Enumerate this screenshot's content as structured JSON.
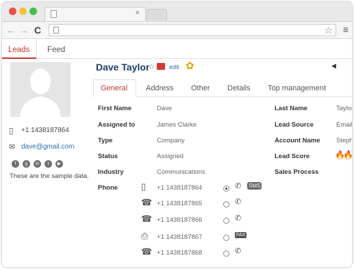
{
  "browser": {
    "close_glyph": "×",
    "menu_glyph": "≡",
    "star_glyph": "☆"
  },
  "app_tabs": [
    {
      "label": "Leads"
    },
    {
      "label": "Feed"
    }
  ],
  "contact": {
    "name": "Dave Taylor",
    "edit_label": "edit",
    "phone": "+1 1438187864",
    "email": "dave@gmail.com",
    "blurb": "These are the sample data."
  },
  "profile_tabs": [
    {
      "label": "General"
    },
    {
      "label": "Address"
    },
    {
      "label": "Other"
    },
    {
      "label": "Details"
    },
    {
      "label": "Top management"
    }
  ],
  "fields_left": [
    {
      "label": "First Name",
      "value": "Dave"
    },
    {
      "label": "Assigned to",
      "value": "James Clarke"
    },
    {
      "label": "Type",
      "value": "Company"
    },
    {
      "label": "Status",
      "value": "Assigned"
    },
    {
      "label": "Industry",
      "value": "Communications"
    },
    {
      "label": "Phone",
      "value": ""
    }
  ],
  "fields_right": [
    {
      "label": "Last Name",
      "value": "Taylor"
    },
    {
      "label": "Lead Source",
      "value": "Email"
    },
    {
      "label": "Account Name",
      "value": "Steph"
    },
    {
      "label": "Lead Score",
      "value": ""
    },
    {
      "label": "Sales Process",
      "value": ""
    }
  ],
  "phones": [
    {
      "number": "+1 1438187864",
      "icon": "mobile-icon",
      "selected": true
    },
    {
      "number": "+1 1438187865",
      "icon": "office-phone-icon",
      "selected": false
    },
    {
      "number": "+1 1438187866",
      "icon": "home-phone-icon",
      "selected": false
    },
    {
      "number": "+1 1438187867",
      "icon": "fax-icon",
      "selected": false
    },
    {
      "number": "+1 1438187868",
      "icon": "desk-phone-icon",
      "selected": false
    }
  ],
  "colors": {
    "accent": "#c0392b",
    "name": "#1b3f6b",
    "link": "#2a6fb3"
  }
}
